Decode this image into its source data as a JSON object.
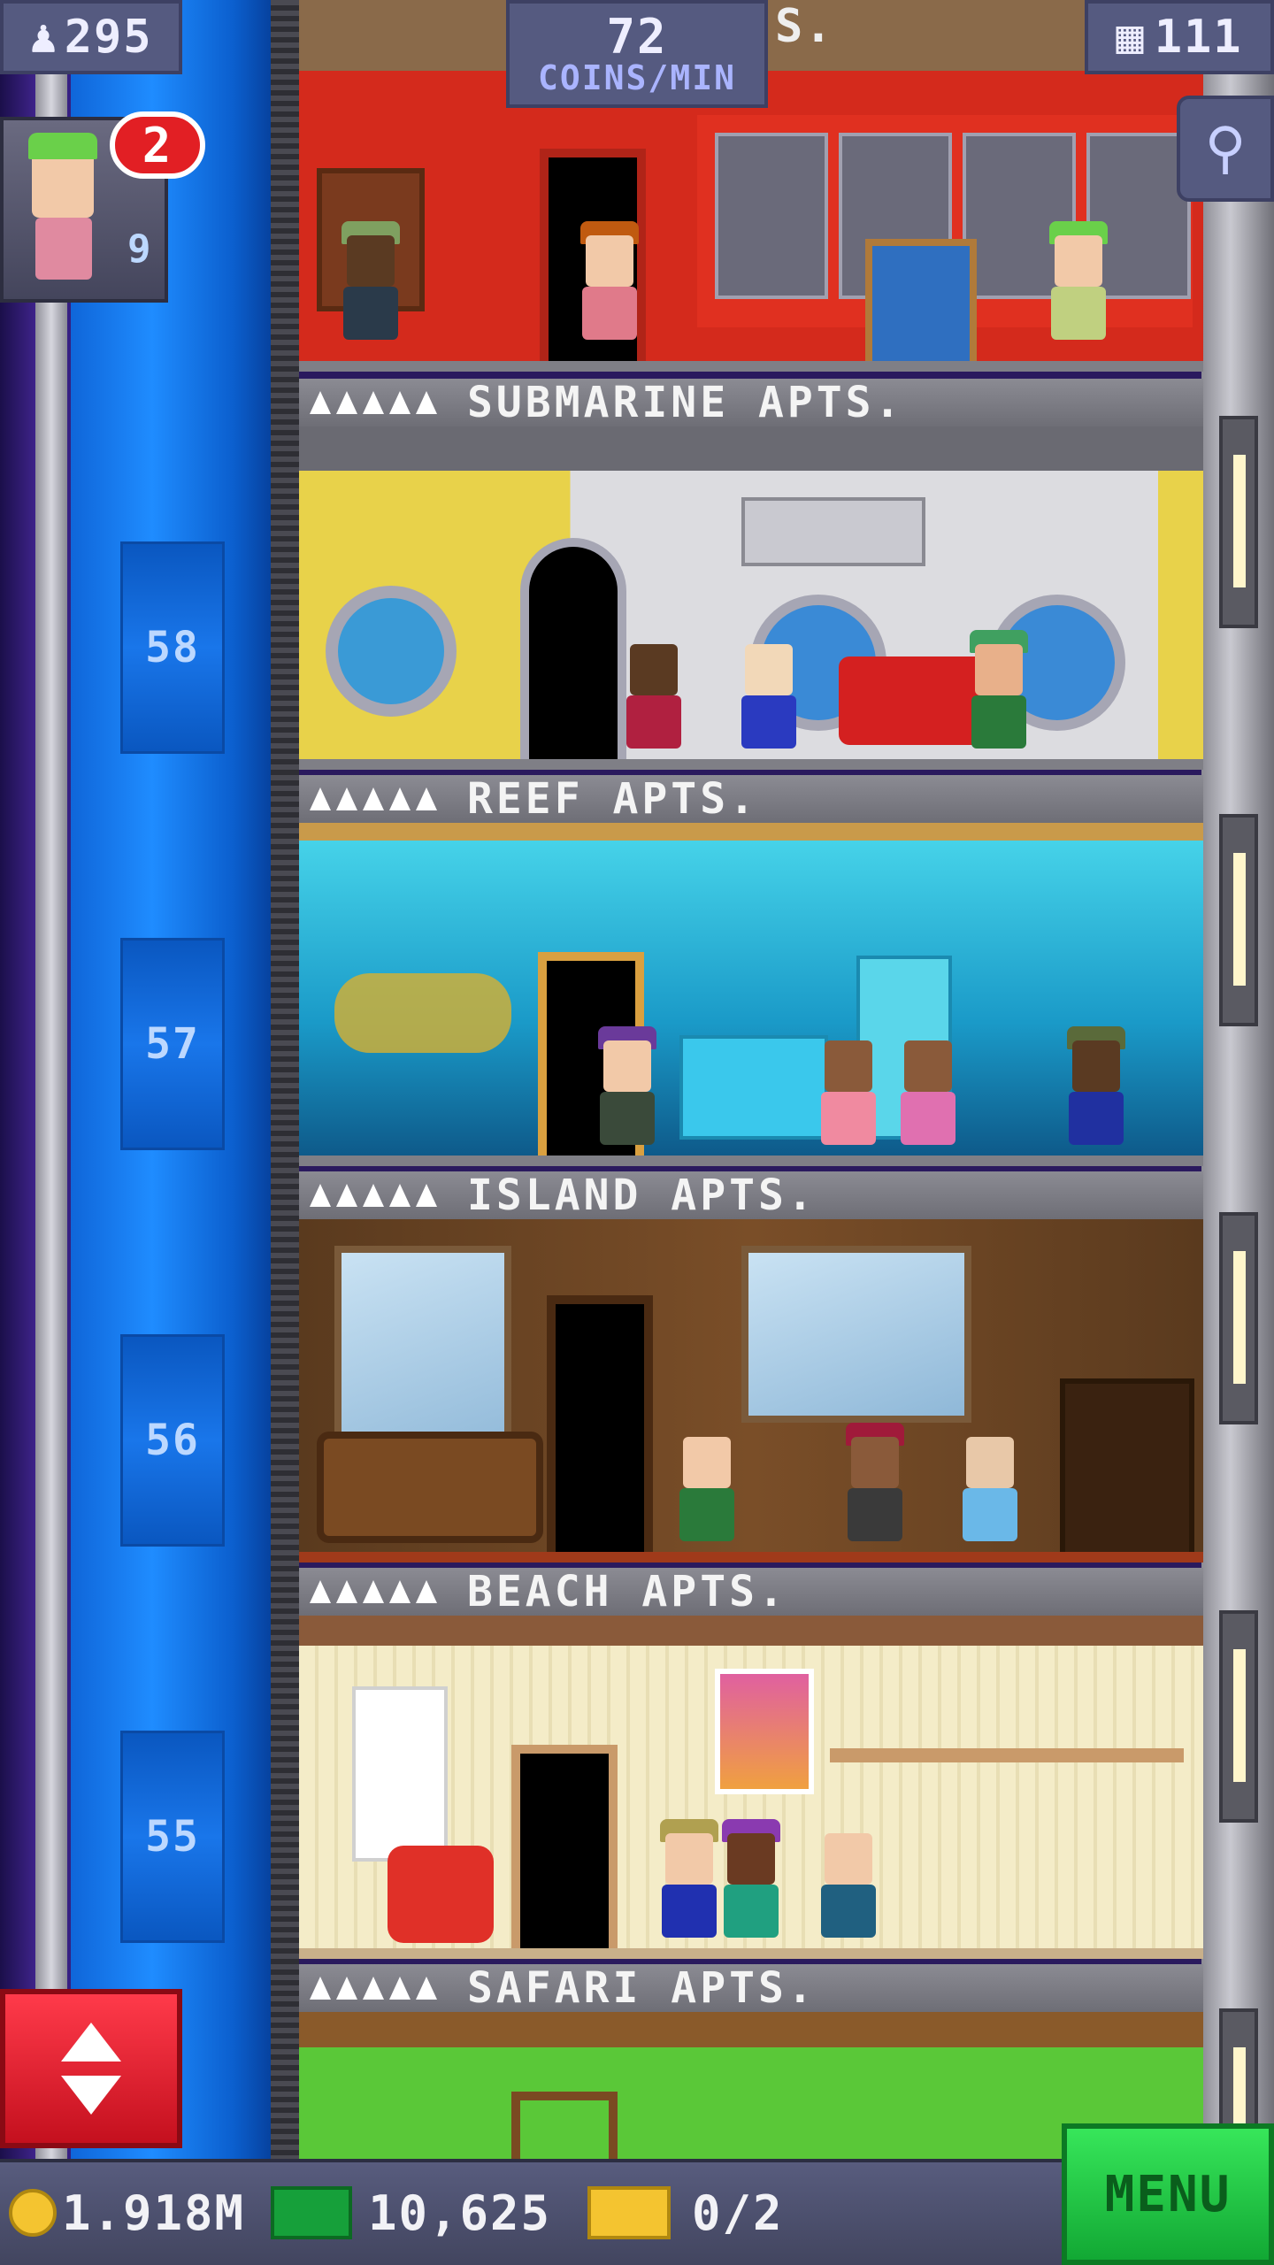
{
  "hud": {
    "population": "295",
    "rate_value": "72",
    "rate_unit": "COINS/MIN",
    "top_room_partial": "S.",
    "floor_count": "111",
    "notifications": "2",
    "partial_floor_number": "9"
  },
  "floors": [
    {
      "number": "58",
      "name": "SUBMARINE APTS."
    },
    {
      "number": "57",
      "name": "REEF APTS."
    },
    {
      "number": "56",
      "name": "ISLAND APTS."
    },
    {
      "number": "55",
      "name": "BEACH APTS."
    },
    {
      "number": "",
      "name": "SAFARI APTS."
    }
  ],
  "bottom": {
    "coins": "1.918M",
    "bux": "10,625",
    "tickets": "0/2",
    "menu_label": "MENU"
  },
  "colors": {
    "shaft_blue": "#1f8cff",
    "menu_green": "#22c23f",
    "elevator_red": "#e0202e",
    "hud_panel": "#555a80"
  }
}
